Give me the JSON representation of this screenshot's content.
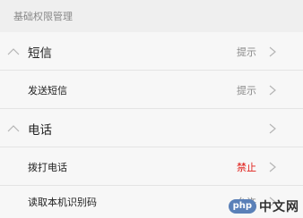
{
  "section_title": "基础权限管理",
  "groups": [
    {
      "label": "短信",
      "status": "提示",
      "items": [
        {
          "label": "发送短信",
          "status": "提示"
        }
      ]
    },
    {
      "label": "电话",
      "status": "",
      "items": [
        {
          "label": "拨打电话",
          "status": "禁止"
        },
        {
          "label": "读取本机识别码",
          "status": "允许"
        }
      ]
    }
  ],
  "icons": {
    "collapse": "chevron-up-icon",
    "row_arrow": "chevron-right-icon"
  },
  "colors": {
    "deny_status": "#e0201b",
    "neutral_status": "#8a8a8a",
    "header_bg": "#efefef",
    "row_bg": "#f7f7f7"
  },
  "watermark": {
    "badge": "php",
    "text": "中文网"
  }
}
